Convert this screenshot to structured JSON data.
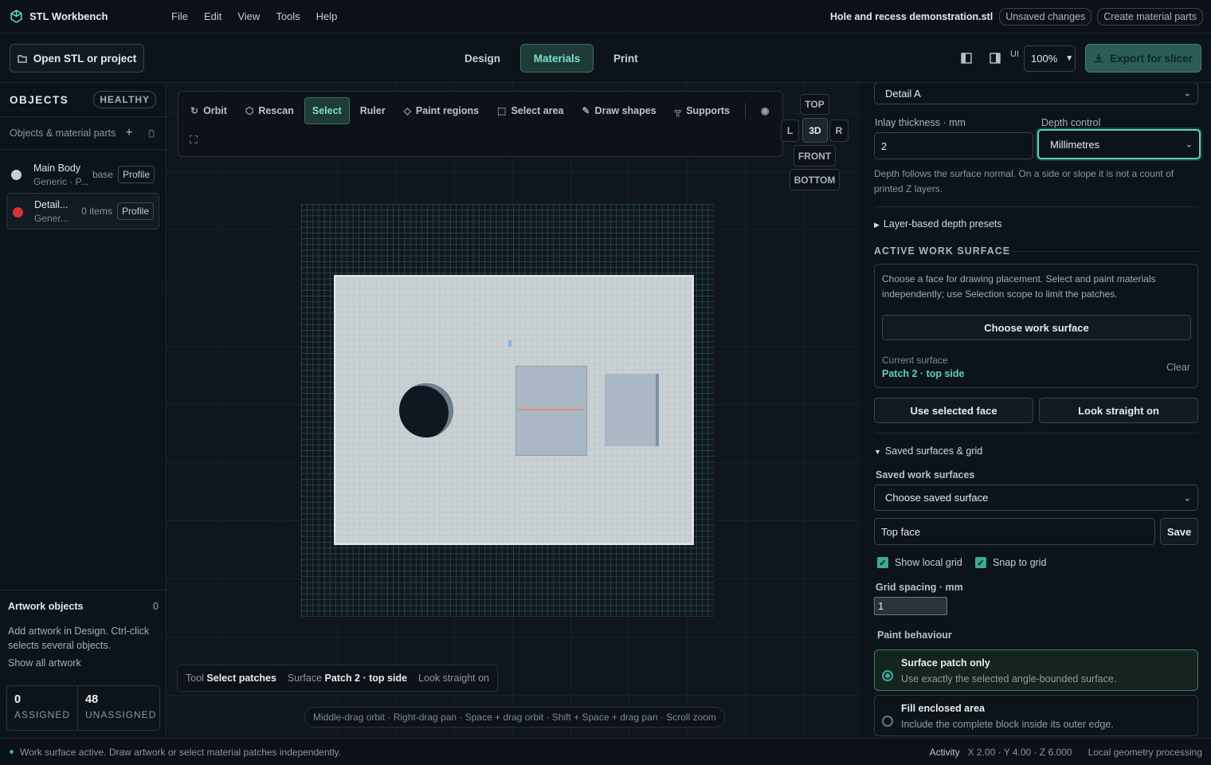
{
  "app": {
    "name": "STL Workbench",
    "menu": [
      "File",
      "Edit",
      "View",
      "Tools",
      "Help"
    ],
    "file_name": "Hole and recess demonstration.stl",
    "unsaved": "Unsaved changes",
    "create_parts": "Create material parts"
  },
  "toolbar": {
    "open": "Open STL or project",
    "modes": [
      "Design",
      "Materials",
      "Print"
    ],
    "active_mode": "Materials",
    "ui_label": "UI",
    "zoom": "100%",
    "export": "Export for slicer"
  },
  "objects": {
    "title": "OBJECTS",
    "health": "HEALTHY",
    "subtitle": "Objects & material parts",
    "items": [
      {
        "name": "Main Body",
        "sub": "Generic · P...",
        "meta": "base",
        "profile": "Profile",
        "color": "#c9ced2"
      },
      {
        "name": "Detail...",
        "sub": "Gener...",
        "meta": "0 items",
        "profile": "Profile",
        "color": "#d2352d"
      }
    ]
  },
  "artwork": {
    "title": "Artwork objects",
    "count": "0",
    "text": "Add artwork in Design. Ctrl-click selects several objects.",
    "link": "Show all artwork",
    "assigned": "0",
    "assigned_label": "ASSIGNED",
    "unassigned": "48",
    "unassigned_label": "UNASSIGNED"
  },
  "viewport": {
    "tools": [
      "Orbit",
      "Rescan",
      "Select",
      "Ruler",
      "Paint regions",
      "Select area",
      "Draw shapes",
      "Supports"
    ],
    "active_tool": "Select",
    "views": {
      "top": "TOP",
      "l": "L",
      "3d": "3D",
      "r": "R",
      "front": "FRONT",
      "bottom": "BOTTOM"
    },
    "status": {
      "tool_label": "Tool",
      "tool": "Select patches",
      "surface_label": "Surface",
      "surface": "Patch 2 · top side",
      "look": "Look straight on"
    },
    "hint": "Middle-drag orbit · Right-drag pan · Space + drag orbit · Shift + Space + drag pan · Scroll zoom"
  },
  "panel": {
    "detail_select": "Detail A",
    "inlay_label": "Inlay thickness · mm",
    "inlay_value": "2",
    "depth_label": "Depth control",
    "depth_value": "Millimetres",
    "depth_note": "Depth follows the surface normal. On a side or slope it is not a count of printed Z layers.",
    "presets": "Layer-based depth presets",
    "ws_title": "ACTIVE WORK SURFACE",
    "ws_text": "Choose a face for drawing placement. Select and paint materials independently; use Selection scope to limit the patches.",
    "ws_button": "Choose work surface",
    "current_label": "Current surface",
    "current_value": "Patch 2 · top side",
    "clear": "Clear",
    "use_face": "Use selected face",
    "look": "Look straight on",
    "saved_section": "Saved surfaces & grid",
    "saved_label": "Saved work surfaces",
    "saved_select": "Choose saved surface",
    "name_value": "Top face",
    "save": "Save",
    "show_grid": "Show local grid",
    "snap": "Snap to grid",
    "spacing_label": "Grid spacing · mm",
    "spacing_value": "1",
    "paint_label": "Paint behaviour",
    "opt1_title": "Surface patch only",
    "opt1_text": "Use exactly the selected angle-bounded surface.",
    "opt2_title": "Fill enclosed area",
    "opt2_text": "Include the complete block inside its outer edge."
  },
  "footer": {
    "message": "Work surface active. Draw artwork or select material patches independently.",
    "activity": "Activity",
    "coords": "X 2.00 · Y 4.00 · Z 6.000",
    "processing": "Local geometry processing"
  },
  "colors": {
    "accent": "#3fa896",
    "accent_text": "#78e0cb",
    "background": "#0d1419"
  }
}
